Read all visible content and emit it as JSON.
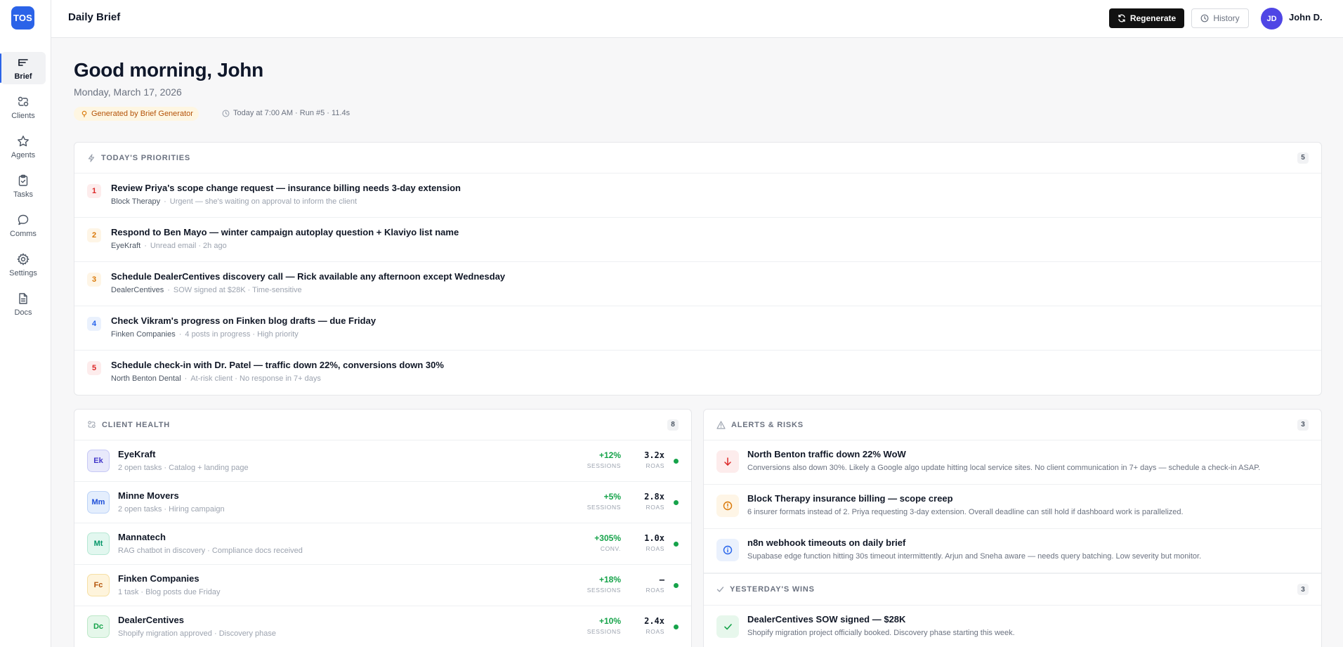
{
  "app": {
    "logo": "TOS"
  },
  "sidebar": {
    "items": [
      {
        "label": "Brief",
        "icon": "brief-icon",
        "active": true
      },
      {
        "label": "Clients",
        "icon": "users-icon"
      },
      {
        "label": "Agents",
        "icon": "star-icon"
      },
      {
        "label": "Tasks",
        "icon": "clipboard-icon"
      },
      {
        "label": "Comms",
        "icon": "chat-icon"
      },
      {
        "label": "Settings",
        "icon": "gear-icon"
      },
      {
        "label": "Docs",
        "icon": "document-icon"
      }
    ]
  },
  "header": {
    "title": "Daily Brief",
    "regenerate_label": "Regenerate",
    "history_label": "History",
    "user_initials": "JD",
    "user_name": "John D."
  },
  "greeting": {
    "title": "Good morning, John",
    "date": "Monday, March 17, 2026",
    "generated_by": "Generated by Brief Generator",
    "run_meta": "Today at 7:00 AM · Run #5 · 11.4s"
  },
  "priorities": {
    "title": "TODAY'S PRIORITIES",
    "count": "5",
    "items": [
      {
        "num": "1",
        "title": "Review Priya's scope change request — insurance billing needs 3-day extension",
        "client": "Block Therapy",
        "detail": "Urgent — she's waiting on approval to inform the client",
        "color": "#dc2626",
        "bg": "#fdecec"
      },
      {
        "num": "2",
        "title": "Respond to Ben Mayo — winter campaign autoplay question + Klaviyo list name",
        "client": "EyeKraft",
        "detail": "Unread email · 2h ago",
        "color": "#d97706",
        "bg": "#fef5e6"
      },
      {
        "num": "3",
        "title": "Schedule DealerCentives discovery call — Rick available any afternoon except Wednesday",
        "client": "DealerCentives",
        "detail": "SOW signed at $28K · Time-sensitive",
        "color": "#d97706",
        "bg": "#fef5e6"
      },
      {
        "num": "4",
        "title": "Check Vikram's progress on Finken blog drafts — due Friday",
        "client": "Finken Companies",
        "detail": "4 posts in progress · High priority",
        "color": "#2563eb",
        "bg": "#eaf1fd"
      },
      {
        "num": "5",
        "title": "Schedule check-in with Dr. Patel — traffic down 22%, conversions down 30%",
        "client": "North Benton Dental",
        "detail": "At-risk client · No response in 7+ days",
        "color": "#dc2626",
        "bg": "#fdecec"
      }
    ]
  },
  "client_health": {
    "title": "CLIENT HEALTH",
    "count": "8",
    "items": [
      {
        "initials": "Ek",
        "name": "EyeKraft",
        "sub": "2 open tasks · Catalog + landing page",
        "change": "+12%",
        "change_label": "SESSIONS",
        "roas": "3.2x",
        "roas_label": "ROAS",
        "color": "#4338ca",
        "bg": "#e8e9fb",
        "border": "#c7c9f5"
      },
      {
        "initials": "Mm",
        "name": "Minne Movers",
        "sub": "2 open tasks · Hiring campaign",
        "change": "+5%",
        "change_label": "SESSIONS",
        "roas": "2.8x",
        "roas_label": "ROAS",
        "color": "#1d4ed8",
        "bg": "#e4eefd",
        "border": "#bcd3f7"
      },
      {
        "initials": "Mt",
        "name": "Mannatech",
        "sub": "RAG chatbot in discovery · Compliance docs received",
        "change": "+305%",
        "change_label": "CONV.",
        "roas": "1.0x",
        "roas_label": "ROAS",
        "color": "#059669",
        "bg": "#e2f7ef",
        "border": "#b6e8d4"
      },
      {
        "initials": "Fc",
        "name": "Finken Companies",
        "sub": "1 task · Blog posts due Friday",
        "change": "+18%",
        "change_label": "SESSIONS",
        "roas": "—",
        "roas_label": "ROAS",
        "color": "#b45309",
        "bg": "#fef4dc",
        "border": "#f6dfa4"
      },
      {
        "initials": "Dc",
        "name": "DealerCentives",
        "sub": "Shopify migration approved · Discovery phase",
        "change": "+10%",
        "change_label": "SESSIONS",
        "roas": "2.4x",
        "roas_label": "ROAS",
        "color": "#16a34a",
        "bg": "#e5f7ea",
        "border": "#bde8c8"
      }
    ]
  },
  "alerts": {
    "title": "ALERTS & RISKS",
    "count": "3",
    "items": [
      {
        "icon": "arrow-down-icon",
        "title": "North Benton traffic down 22% WoW",
        "desc": "Conversions also down 30%. Likely a Google algo update hitting local service sites. No client communication in 7+ days — schedule a check-in ASAP.",
        "color": "#dc2626",
        "bg": "#fdecec"
      },
      {
        "icon": "alert-circle-icon",
        "title": "Block Therapy insurance billing — scope creep",
        "desc": "6 insurer formats instead of 2. Priya requesting 3-day extension. Overall deadline can still hold if dashboard work is parallelized.",
        "color": "#d97706",
        "bg": "#fef5e6"
      },
      {
        "icon": "info-icon",
        "title": "n8n webhook timeouts on daily brief",
        "desc": "Supabase edge function hitting 30s timeout intermittently. Arjun and Sneha aware — needs query batching. Low severity but monitor.",
        "color": "#2563eb",
        "bg": "#eaf1fd"
      }
    ]
  },
  "wins": {
    "title": "YESTERDAY'S WINS",
    "count": "3",
    "items": [
      {
        "icon": "check-icon",
        "title": "DealerCentives SOW signed — $28K",
        "desc": "Shopify migration project officially booked. Discovery phase starting this week.",
        "color": "#16a34a",
        "bg": "#e7f7ec"
      }
    ]
  }
}
